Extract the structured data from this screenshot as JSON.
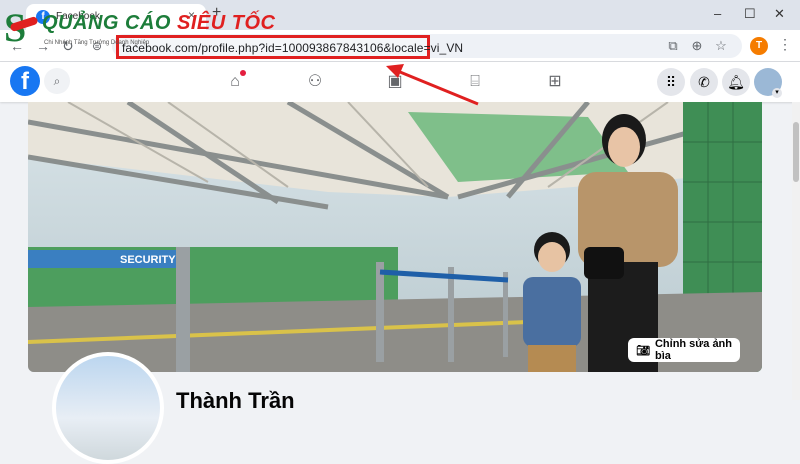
{
  "browser": {
    "tab_title": "Facebook",
    "tab_close": "×",
    "new_tab": "+",
    "url": "facebook.com/profile.php?id=100093867843106&locale=vi_VN",
    "profile_initial": "T",
    "window_controls": {
      "minimize": "–",
      "maximize": "☐",
      "close": "✕"
    }
  },
  "overlay_logo": {
    "text_green": "QUẢNG CÁO ",
    "text_red": "SIÊU TỐC",
    "subtitle": "Chi Nhánh Tăng Trưởng Doanh Nghiệp"
  },
  "facebook": {
    "logo_letter": "f",
    "nav_icons": [
      "home-icon",
      "friends-icon",
      "watch-icon",
      "marketplace-icon",
      "gaming-icon"
    ],
    "right_icons": [
      "menu-grid-icon",
      "messenger-icon",
      "notifications-icon",
      "account-avatar"
    ],
    "edit_cover_label": "Chỉnh sửa ảnh bìa",
    "profile_name": "Thành Trần"
  },
  "colors": {
    "facebook_blue": "#1877f2",
    "highlight_red": "#e02020",
    "logo_green": "#1d7d3a",
    "notification_red": "#e41e3f"
  }
}
